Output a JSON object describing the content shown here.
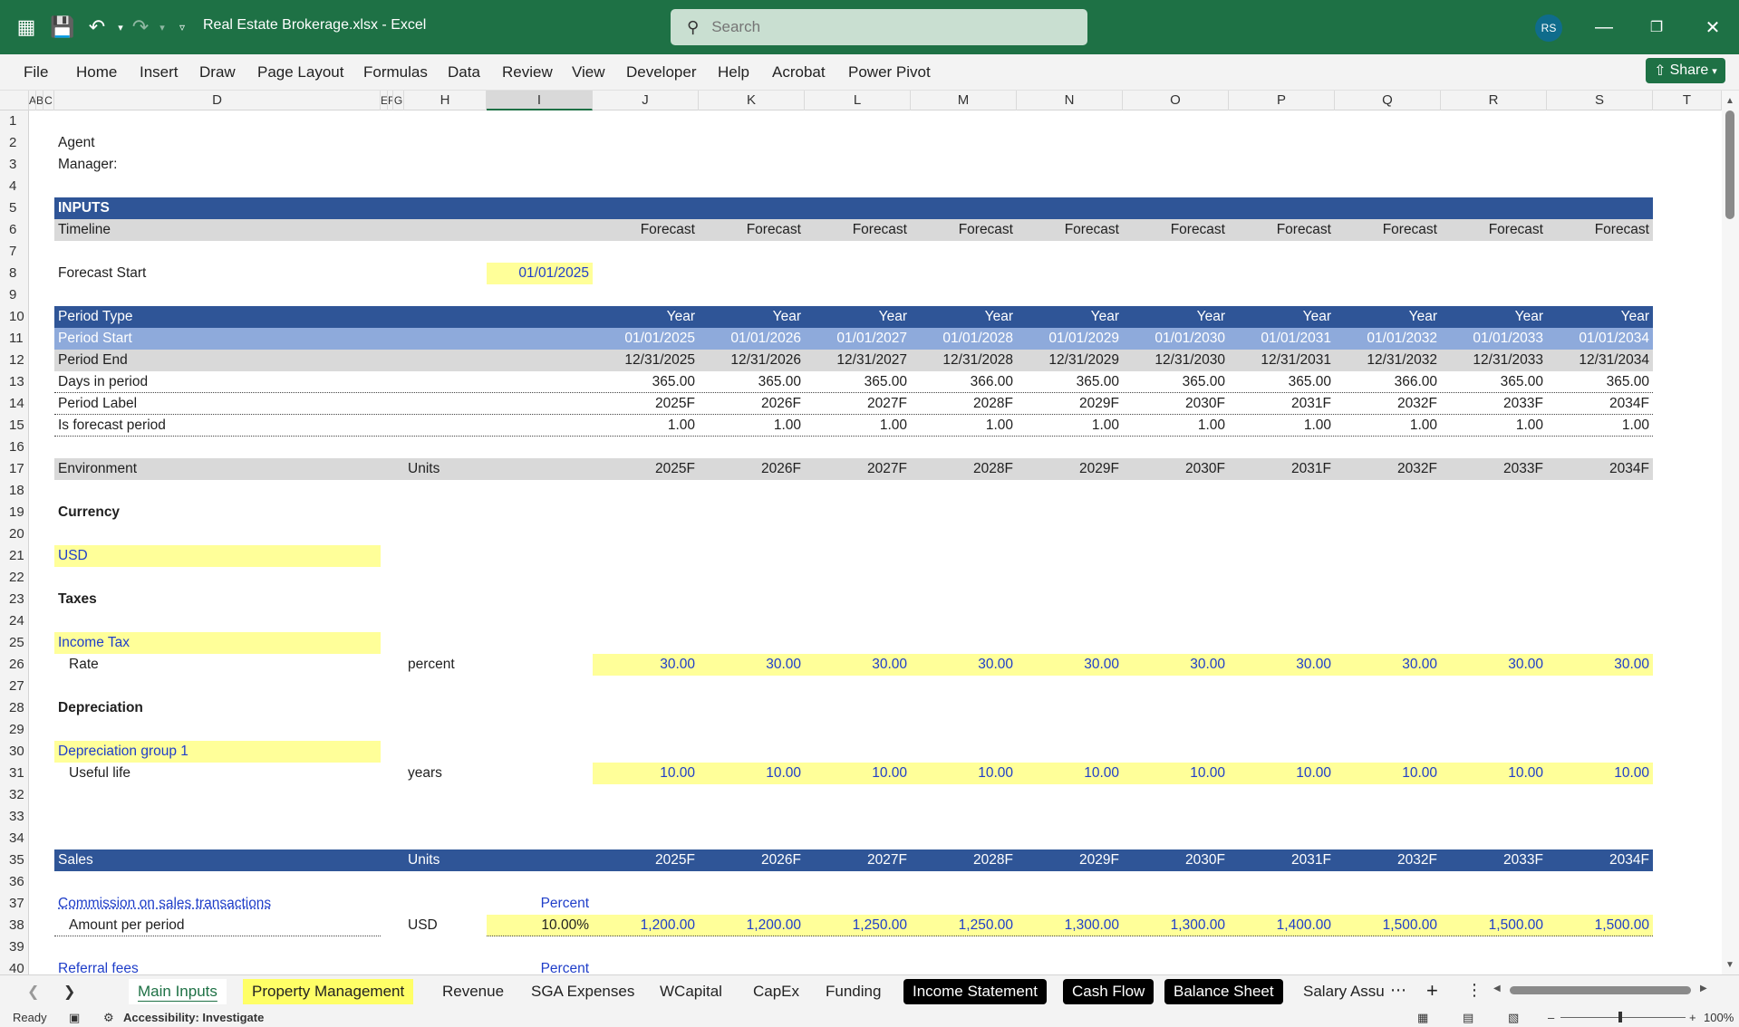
{
  "window": {
    "file_title": "Real Estate Brokerage.xlsx  -  Excel",
    "search_placeholder": "Search",
    "user_initials": "RS"
  },
  "ribbon_tabs": [
    "File",
    "Home",
    "Insert",
    "Draw",
    "Page Layout",
    "Formulas",
    "Data",
    "Review",
    "View",
    "Developer",
    "Help",
    "Acrobat",
    "Power Pivot"
  ],
  "share_label": "Share",
  "column_headers": [
    "A",
    "B",
    "C",
    "D",
    "E",
    "F",
    "G",
    "H",
    "I",
    "J",
    "K",
    "L",
    "M",
    "N",
    "O",
    "P",
    "Q",
    "R",
    "S",
    "T"
  ],
  "selected_column": "I",
  "row_numbers": [
    "1",
    "2",
    "3",
    "4",
    "5",
    "6",
    "7",
    "8",
    "9",
    "10",
    "11",
    "12",
    "13",
    "14",
    "15",
    "16",
    "17",
    "18",
    "19",
    "20",
    "21",
    "22",
    "23",
    "24",
    "25",
    "26",
    "27",
    "28",
    "29",
    "30",
    "31",
    "32",
    "33",
    "34",
    "35",
    "36",
    "37",
    "38",
    "39",
    "40"
  ],
  "sheet": {
    "agent_label": "Agent",
    "manager_label": "Manager:",
    "inputs_header": "INPUTS",
    "timeline_label": "Timeline",
    "timeline_values": [
      "Forecast",
      "Forecast",
      "Forecast",
      "Forecast",
      "Forecast",
      "Forecast",
      "Forecast",
      "Forecast",
      "Forecast",
      "Forecast"
    ],
    "forecast_start_label": "Forecast Start",
    "forecast_start_value": "01/01/2025",
    "period_type_label": "Period Type",
    "period_type_values": [
      "Year",
      "Year",
      "Year",
      "Year",
      "Year",
      "Year",
      "Year",
      "Year",
      "Year",
      "Year"
    ],
    "period_start_label": "Period Start",
    "period_start_values": [
      "01/01/2025",
      "01/01/2026",
      "01/01/2027",
      "01/01/2028",
      "01/01/2029",
      "01/01/2030",
      "01/01/2031",
      "01/01/2032",
      "01/01/2033",
      "01/01/2034"
    ],
    "period_end_label": "Period End",
    "period_end_values": [
      "12/31/2025",
      "12/31/2026",
      "12/31/2027",
      "12/31/2028",
      "12/31/2029",
      "12/31/2030",
      "12/31/2031",
      "12/31/2032",
      "12/31/2033",
      "12/31/2034"
    ],
    "days_label": "Days in period",
    "days_values": [
      "365.00",
      "365.00",
      "365.00",
      "366.00",
      "365.00",
      "365.00",
      "365.00",
      "366.00",
      "365.00",
      "365.00"
    ],
    "period_label_label": "Period Label",
    "period_label_values": [
      "2025F",
      "2026F",
      "2027F",
      "2028F",
      "2029F",
      "2030F",
      "2031F",
      "2032F",
      "2033F",
      "2034F"
    ],
    "is_forecast_label": "Is forecast period",
    "is_forecast_values": [
      "1.00",
      "1.00",
      "1.00",
      "1.00",
      "1.00",
      "1.00",
      "1.00",
      "1.00",
      "1.00",
      "1.00"
    ],
    "environment_label": "Environment",
    "units_label": "Units",
    "year_labels": [
      "2025F",
      "2026F",
      "2027F",
      "2028F",
      "2029F",
      "2030F",
      "2031F",
      "2032F",
      "2033F",
      "2034F"
    ],
    "currency_label": "Currency",
    "currency_value": "USD",
    "taxes_label": "Taxes",
    "income_tax_label": "Income Tax",
    "rate_label": "Rate",
    "rate_units": "percent",
    "rate_values": [
      "30.00",
      "30.00",
      "30.00",
      "30.00",
      "30.00",
      "30.00",
      "30.00",
      "30.00",
      "30.00",
      "30.00"
    ],
    "depreciation_label": "Depreciation",
    "dep_group_label": "Depreciation group 1",
    "useful_life_label": "Useful life",
    "useful_life_units": "years",
    "useful_life_values": [
      "10.00",
      "10.00",
      "10.00",
      "10.00",
      "10.00",
      "10.00",
      "10.00",
      "10.00",
      "10.00",
      "10.00"
    ],
    "sales_label": "Sales",
    "commission_label": "Commission on sales transactions",
    "percent_label": "Percent",
    "amount_label": "Amount per period",
    "amount_units": "USD",
    "amount_percent": "10.00%",
    "amount_values": [
      "1,200.00",
      "1,200.00",
      "1,250.00",
      "1,250.00",
      "1,300.00",
      "1,300.00",
      "1,400.00",
      "1,500.00",
      "1,500.00",
      "1,500.00"
    ],
    "referral_label": "Referral fees",
    "referral_percent_label": "Percent"
  },
  "sheet_tabs": [
    {
      "label": "Main Inputs",
      "style": "active"
    },
    {
      "label": "Property Management",
      "style": "yellow"
    },
    {
      "label": "Revenue",
      "style": "plain"
    },
    {
      "label": "SGA Expenses",
      "style": "plain"
    },
    {
      "label": "WCapital",
      "style": "plain"
    },
    {
      "label": "CapEx",
      "style": "plain"
    },
    {
      "label": "Funding",
      "style": "plain"
    },
    {
      "label": "Income Statement",
      "style": "black"
    },
    {
      "label": "Cash Flow",
      "style": "black"
    },
    {
      "label": "Balance Sheet",
      "style": "black"
    },
    {
      "label": "Salary Assu",
      "style": "plain"
    }
  ],
  "status": {
    "ready": "Ready",
    "accessibility": "Accessibility: Investigate",
    "zoom": "100%"
  },
  "colors": {
    "excel_green": "#1e7145",
    "header_navy": "#2f5597",
    "period_start_blue": "#8eaadb",
    "grey_band": "#d9d9d9",
    "input_yellow": "#ffff99",
    "input_text_blue": "#1f3ec9"
  }
}
